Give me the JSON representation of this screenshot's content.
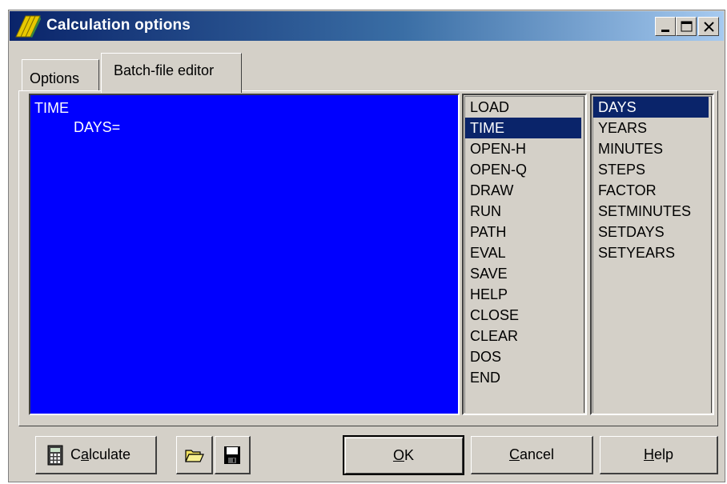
{
  "window": {
    "title": "Calculation options",
    "controls": {
      "minimize": "minimize-icon",
      "maximize": "maximize-icon",
      "close": "close-icon"
    }
  },
  "tabs": [
    {
      "label": "Options",
      "active": false
    },
    {
      "label": "Batch-file editor",
      "active": true
    }
  ],
  "editor": {
    "lines": [
      "TIME",
      "DAYS="
    ],
    "background": "#0000ff",
    "text_color": "#ffffff"
  },
  "command_list": {
    "items": [
      "LOAD",
      "TIME",
      "OPEN-H",
      "OPEN-Q",
      "DRAW",
      "RUN",
      "PATH",
      "EVAL",
      "SAVE",
      "HELP",
      "CLOSE",
      "CLEAR",
      "DOS",
      "END"
    ],
    "selected": "TIME"
  },
  "param_list": {
    "items": [
      "DAYS",
      "YEARS",
      "MINUTES",
      "STEPS",
      "FACTOR",
      "SETMINUTES",
      "SETDAYS",
      "SETYEARS"
    ],
    "selected": "DAYS"
  },
  "buttons": {
    "calculate": {
      "pre": "C",
      "mnemonic": "a",
      "post": "lculate",
      "icon": "calculator-icon"
    },
    "open": {
      "icon": "folder-open-icon"
    },
    "save": {
      "icon": "floppy-disk-icon"
    },
    "ok": {
      "mnemonic": "O",
      "post": "K"
    },
    "cancel": {
      "mnemonic": "C",
      "post": "ancel"
    },
    "help": {
      "mnemonic": "H",
      "post": "elp"
    }
  },
  "colors": {
    "face": "#d4d0c8",
    "selection": "#0a246a",
    "title_start": "#0a246a",
    "title_end": "#a6caf0"
  }
}
